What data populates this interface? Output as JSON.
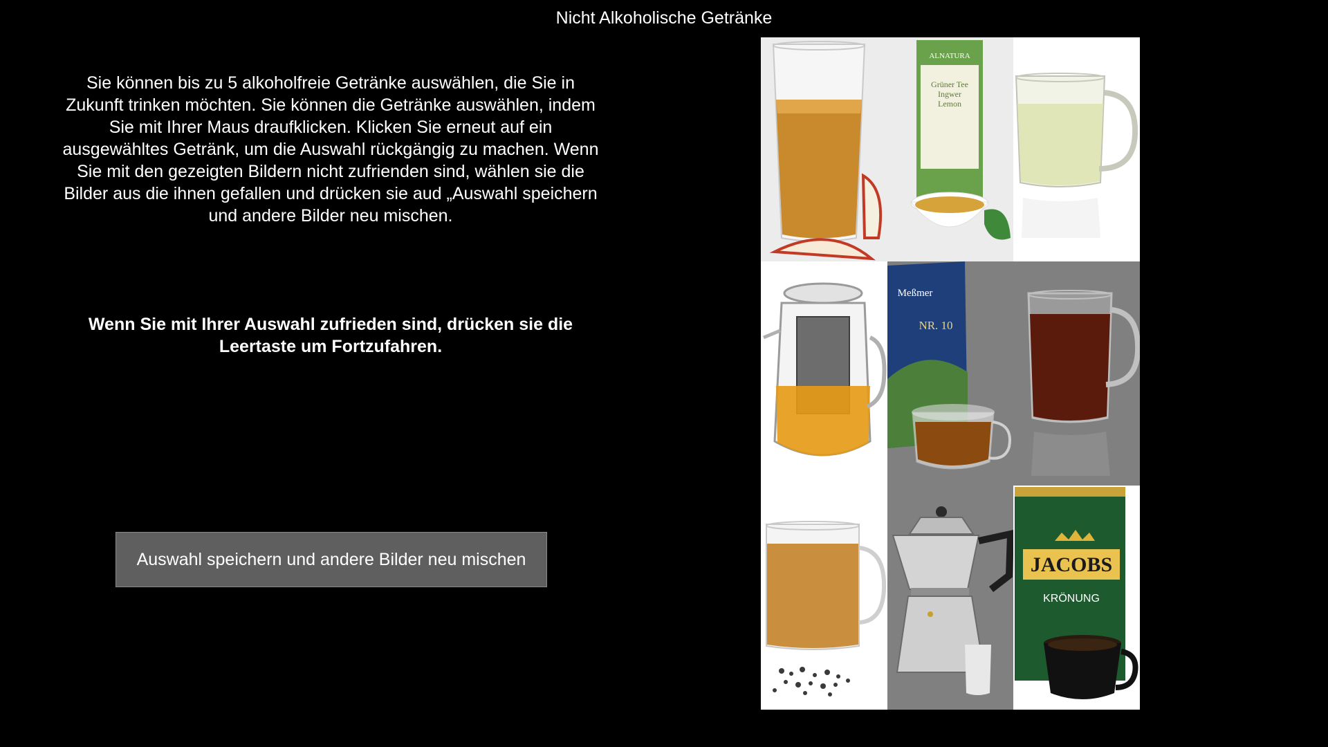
{
  "header": {
    "title": "Nicht Alkoholische Getränke"
  },
  "instructions": {
    "text": "Sie können bis zu 5 alkoholfreie Getränke auswählen, die Sie in Zukunft trinken möchten. Sie können die Getränke auswählen, indem Sie mit Ihrer Maus draufklicken. Klicken Sie erneut auf ein ausgewähltes Getränk, um die Auswahl rückgängig zu machen. Wenn Sie mit den gezeigten Bildern nicht zufrienden sind, wählen sie die Bilder aus die ihnen gefallen und drücken sie aud „Auswahl speichern und andere Bilder neu mischen."
  },
  "continue_hint": {
    "text": "Wenn Sie mit Ihrer Auswahl zufrieden sind, drücken sie die Leertaste um Fortzufahren."
  },
  "shuffle_button": {
    "label": "Auswahl speichern und andere Bilder neu mischen"
  },
  "tiles": [
    {
      "name": "apple-juice-glass",
      "icon": "juice-glass-icon"
    },
    {
      "name": "green-tea-package",
      "icon": "tea-box-icon",
      "brand": "ALNATURA",
      "label1": "Grüner Tee",
      "label2": "Ingwer",
      "label3": "Lemon"
    },
    {
      "name": "green-tea-cup",
      "icon": "tea-cup-icon"
    },
    {
      "name": "glass-teapot",
      "icon": "teapot-icon"
    },
    {
      "name": "messmer-tea-package",
      "icon": "tea-box-icon",
      "brand": "Meßmer",
      "label1": "NR. 10"
    },
    {
      "name": "black-tea-cup",
      "icon": "tea-cup-icon"
    },
    {
      "name": "tea-glass-with-leaves",
      "icon": "tea-glass-icon"
    },
    {
      "name": "espresso-maker",
      "icon": "moka-pot-icon"
    },
    {
      "name": "jacobs-coffee-package",
      "icon": "coffee-pack-icon",
      "brand": "JACOBS",
      "label1": "KRÖNUNG"
    }
  ],
  "colors": {
    "background": "#000000",
    "button": "#5f5f5f",
    "text": "#ffffff"
  }
}
